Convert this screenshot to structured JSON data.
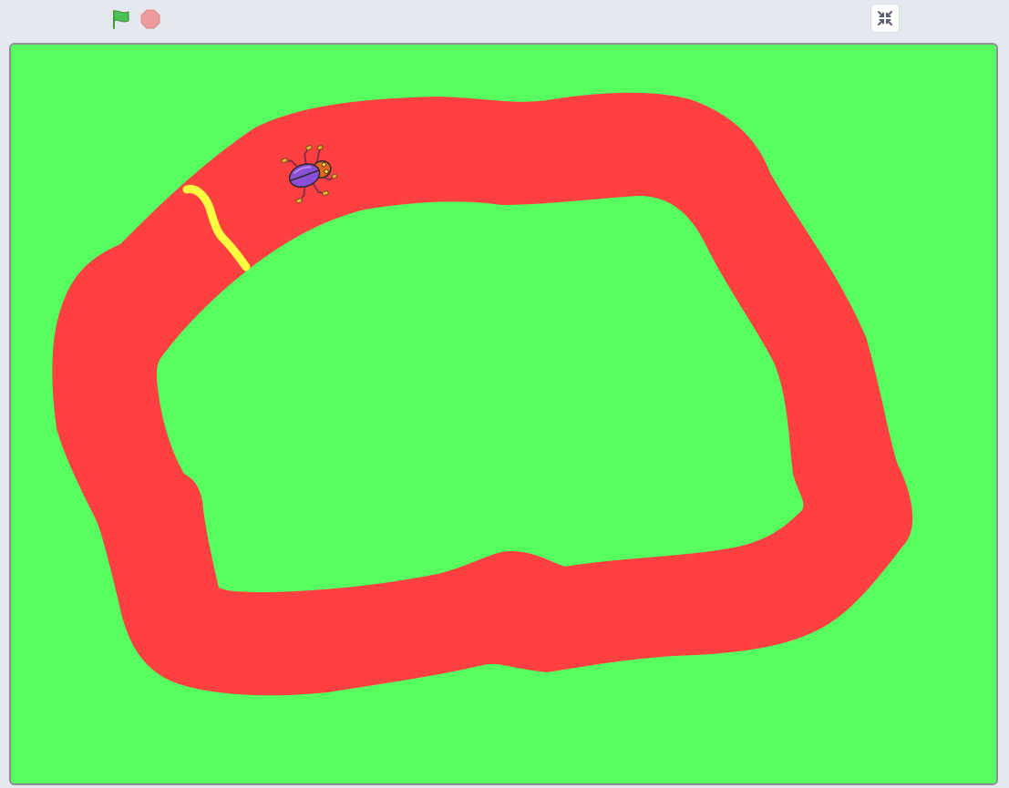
{
  "toolbar": {
    "green_flag_icon": "green-flag-icon",
    "stop_icon": "stop-sign-icon",
    "fullscreen_icon": "exit-fullscreen-icon"
  },
  "stage": {
    "background_color": "#57fe5f",
    "track_color": "#ff4040",
    "finish_line_color": "#ffff40",
    "sprite": "beetle"
  },
  "colors": {
    "flag_green": "#4cbf56",
    "stop_red": "#ec9c9c",
    "toolbar_bg": "#e5e9ef",
    "stage_border": "#8a9099"
  }
}
